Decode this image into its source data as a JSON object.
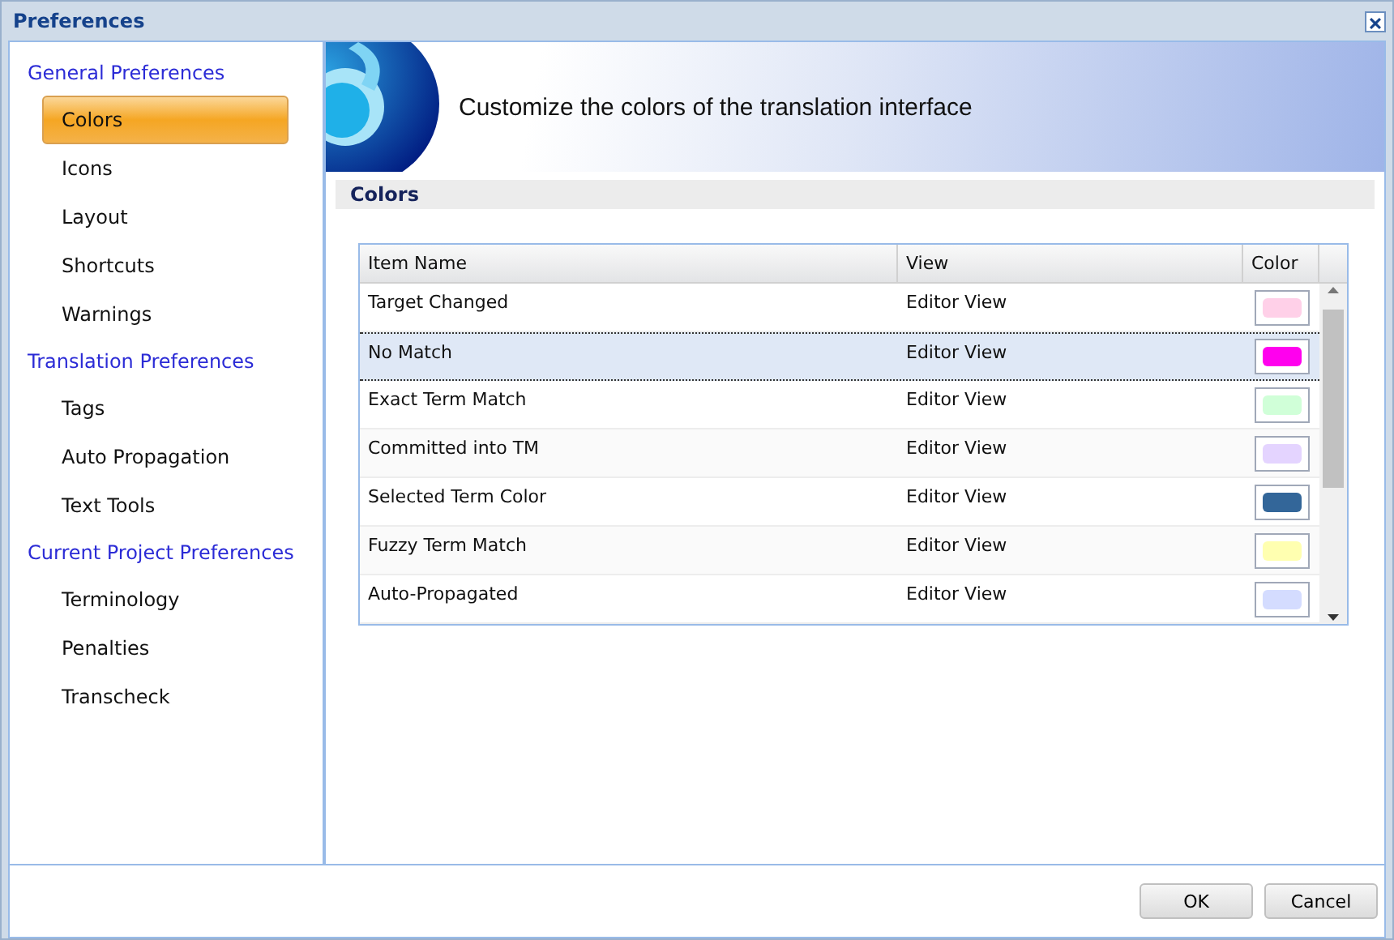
{
  "window": {
    "title": "Preferences"
  },
  "sidebar": {
    "groups": [
      {
        "label": "General Preferences",
        "items": [
          {
            "label": "Colors",
            "selected": true
          },
          {
            "label": "Icons",
            "selected": false
          },
          {
            "label": "Layout",
            "selected": false
          },
          {
            "label": "Shortcuts",
            "selected": false
          },
          {
            "label": "Warnings",
            "selected": false
          }
        ]
      },
      {
        "label": "Translation Preferences",
        "items": [
          {
            "label": "Tags",
            "selected": false
          },
          {
            "label": "Auto Propagation",
            "selected": false
          },
          {
            "label": "Text Tools",
            "selected": false
          }
        ]
      },
      {
        "label": "Current Project Preferences",
        "items": [
          {
            "label": "Terminology",
            "selected": false
          },
          {
            "label": "Penalties",
            "selected": false
          },
          {
            "label": "Transcheck",
            "selected": false
          }
        ]
      }
    ]
  },
  "banner": {
    "text": "Customize the colors of the translation interface"
  },
  "section": {
    "title": "Colors"
  },
  "table": {
    "columns": [
      "Item Name",
      "View",
      "Color"
    ],
    "rows": [
      {
        "name": "Target Changed",
        "view": "Editor View",
        "color": "#ffd0e8",
        "selected": false
      },
      {
        "name": "No Match",
        "view": "Editor View",
        "color": "#ff00ee",
        "selected": true
      },
      {
        "name": "Exact Term Match",
        "view": "Editor View",
        "color": "#d0ffd8",
        "selected": false
      },
      {
        "name": "Committed into TM",
        "view": "Editor View",
        "color": "#e4d4ff",
        "selected": false
      },
      {
        "name": "Selected Term Color",
        "view": "Editor View",
        "color": "#336699",
        "selected": false
      },
      {
        "name": "Fuzzy Term Match",
        "view": "Editor View",
        "color": "#ffffb0",
        "selected": false
      },
      {
        "name": "Auto-Propagated",
        "view": "Editor View",
        "color": "#d4dcff",
        "selected": false
      }
    ]
  },
  "buttons": [
    "OK",
    "Cancel"
  ]
}
